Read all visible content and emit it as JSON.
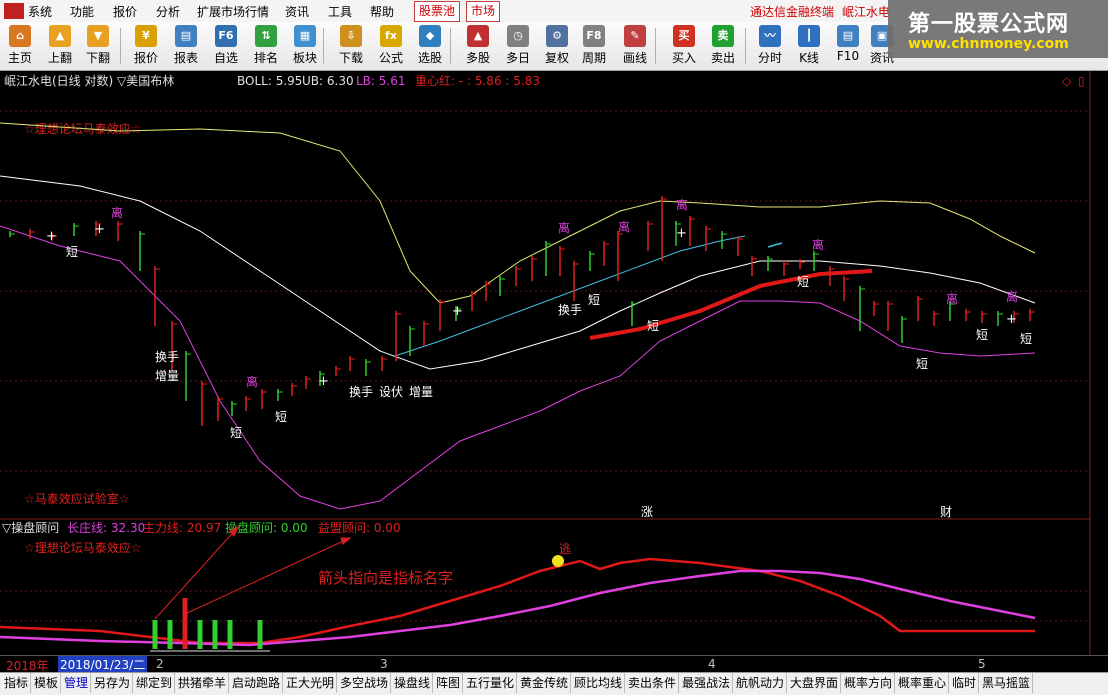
{
  "menu": {
    "items": [
      "系统",
      "功能",
      "报价",
      "分析",
      "扩展市场行情",
      "资讯",
      "工具",
      "帮助"
    ],
    "tabs": [
      "股票池",
      "市场"
    ],
    "right_text": "通达信金融终端",
    "stock_title": "岷江水电"
  },
  "watermark": {
    "title": "第一股票公式网",
    "url": "www.chnmoney.com"
  },
  "toolbar": [
    {
      "label": "主页",
      "icon": "home-icon",
      "glyph": "⌂",
      "color": "#d87820"
    },
    {
      "label": "上翻",
      "icon": "arrow-up-icon",
      "glyph": "▲",
      "color": "#e8a020"
    },
    {
      "label": "下翻",
      "icon": "arrow-down-icon",
      "glyph": "▼",
      "color": "#e8a020"
    },
    {
      "label": "报价",
      "icon": "quote-icon",
      "glyph": "¥",
      "color": "#d8a000"
    },
    {
      "label": "报表",
      "icon": "report-icon",
      "glyph": "▤",
      "color": "#4080c0"
    },
    {
      "label": "自选",
      "icon": "f6-icon",
      "glyph": "F6",
      "color": "#3070b0"
    },
    {
      "label": "排名",
      "icon": "rank-icon",
      "glyph": "⇅",
      "color": "#30a040"
    },
    {
      "label": "板块",
      "icon": "sector-icon",
      "glyph": "▦",
      "color": "#4090d0"
    },
    {
      "label": "下载",
      "icon": "download-icon",
      "glyph": "⇩",
      "color": "#d09020"
    },
    {
      "label": "公式",
      "icon": "formula-icon",
      "glyph": "fx",
      "color": "#d8a800"
    },
    {
      "label": "选股",
      "icon": "stock-pick-icon",
      "glyph": "◆",
      "color": "#3080c0"
    },
    {
      "label": "多股",
      "icon": "multi-stock-icon",
      "glyph": "▲",
      "color": "#c03030"
    },
    {
      "label": "多日",
      "icon": "multi-day-icon",
      "glyph": "◷",
      "color": "#808080"
    },
    {
      "label": "复权",
      "icon": "adjust-icon",
      "glyph": "⚙",
      "color": "#5070a0"
    },
    {
      "label": "周期",
      "icon": "f8-icon",
      "glyph": "F8",
      "color": "#808080"
    },
    {
      "label": "画线",
      "icon": "draw-line-icon",
      "glyph": "✎",
      "color": "#c04040"
    },
    {
      "label": "买入",
      "icon": "buy-icon",
      "glyph": "买",
      "color": "#d03020"
    },
    {
      "label": "卖出",
      "icon": "sell-icon",
      "glyph": "卖",
      "color": "#20a030"
    },
    {
      "label": "分时",
      "icon": "intraday-icon",
      "glyph": "〰",
      "color": "#3070c0"
    },
    {
      "label": "K线",
      "icon": "kline-icon",
      "glyph": "┃",
      "color": "#3070c0"
    },
    {
      "label": "F10",
      "icon": "f10-icon",
      "glyph": "▤",
      "color": "#4080c0"
    },
    {
      "label": "资讯",
      "icon": "news-icon",
      "glyph": "▣",
      "color": "#4080c0"
    }
  ],
  "main_chart": {
    "title": "岷江水电(日线 对数) ▽美国布林",
    "boll_label": "BOLL: 5.95",
    "ub_label": "UB: 6.30",
    "lb_label": "LB: 5.61",
    "zx_label": "重心红: - : 5.86 : 5.83",
    "note_top": "☆理想论坛马泰效应☆",
    "note_bottom": "☆马泰效应试验室☆",
    "annotations": {
      "li": "离",
      "duan": "短",
      "huanshou": "换手",
      "zengliang": "增量",
      "shefu": "设伏",
      "zhang": "涨",
      "cai": "财"
    }
  },
  "sub_chart": {
    "title": "▽操盘顾问",
    "line1": "长庄线: 32.30",
    "line2": "主力线: 20.97",
    "line3": "操盘顾问: 0.00",
    "line4": "益盟顾问: 0.00",
    "note": "☆理想论坛马泰效应☆",
    "arrow_note": "箭头指向是指标名字",
    "sell_mark": "逃"
  },
  "date_bar": {
    "year": "2018年",
    "date": "2018/01/23/二",
    "ticks": [
      "2",
      "3",
      "4",
      "5"
    ]
  },
  "colors": {
    "red": "#e01818",
    "magenta": "#e040e0",
    "cyan": "#40c0e0",
    "white": "#ffffff",
    "yellow": "#e8e870",
    "green": "#30d030"
  },
  "tabs": [
    "指标",
    "模板",
    "管理",
    "另存为",
    "绑定到",
    "拱猪牵羊",
    "启动跑路",
    "正大光明",
    "多空战场",
    "操盘线",
    "阵图",
    "五行量化",
    "黄金传统",
    "顾比均线",
    "卖出条件",
    "最强战法",
    "航帆动力",
    "大盘界面",
    "概率方向",
    "概率重心",
    "临时",
    "黑马摇篮"
  ]
}
